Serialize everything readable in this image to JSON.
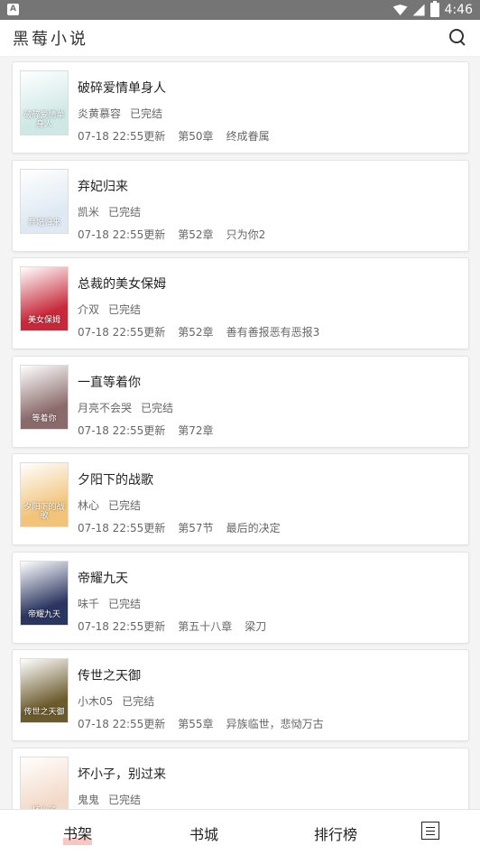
{
  "status_bar": {
    "time": "4:46",
    "app_icon": "A"
  },
  "app": {
    "title": "黑莓小说"
  },
  "books": [
    {
      "title": "破碎爱情单身人",
      "author": "炎黄慕容",
      "status": "已完结",
      "updated": "07-18 22:55更新",
      "chapter": "第50章",
      "chapter_title": "终成眷属",
      "cover_text": "破碎爱情单身人",
      "cover_color": "#cfe8e6"
    },
    {
      "title": "弃妃归来",
      "author": "凯米",
      "status": "已完结",
      "updated": "07-18 22:55更新",
      "chapter": "第52章",
      "chapter_title": "只为你2",
      "cover_text": "弃妃归来",
      "cover_color": "#dfe9f3"
    },
    {
      "title": "总裁的美女保姆",
      "author": "介双",
      "status": "已完结",
      "updated": "07-18 22:55更新",
      "chapter": "第52章",
      "chapter_title": "善有善报恶有恶报3",
      "cover_text": "美女保姆",
      "cover_color": "#c7283a"
    },
    {
      "title": "一直等着你",
      "author": "月亮不会哭",
      "status": "已完结",
      "updated": "07-18 22:55更新",
      "chapter": "第72章",
      "chapter_title": "",
      "cover_text": "等着你",
      "cover_color": "#8a6a6a"
    },
    {
      "title": "夕阳下的战歌",
      "author": "林心",
      "status": "已完结",
      "updated": "07-18 22:55更新",
      "chapter": "第57节",
      "chapter_title": "最后的决定",
      "cover_text": "夕阳下的战歌",
      "cover_color": "#f1c47a"
    },
    {
      "title": "帝耀九天",
      "author": "味千",
      "status": "已完结",
      "updated": "07-18 22:55更新",
      "chapter": "第五十八章",
      "chapter_title": "梁刀",
      "cover_text": "帝耀九天",
      "cover_color": "#2a3560"
    },
    {
      "title": "传世之天御",
      "author": "小木05",
      "status": "已完结",
      "updated": "07-18 22:55更新",
      "chapter": "第55章",
      "chapter_title": "异族临世，悲恸万古",
      "cover_text": "传世之天御",
      "cover_color": "#6b5a2c"
    },
    {
      "title": "坏小子，别过来",
      "author": "鬼鬼",
      "status": "已完结",
      "updated": "",
      "chapter": "",
      "chapter_title": "",
      "cover_text": "坏小子",
      "cover_color": "#f3d9c8"
    }
  ],
  "nav": {
    "bookshelf": "书架",
    "bookstore": "书城",
    "ranking": "排行榜"
  }
}
